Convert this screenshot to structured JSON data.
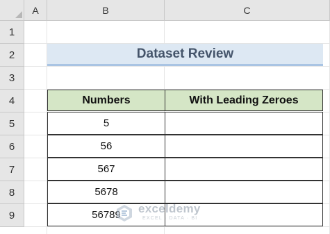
{
  "columns": [
    "A",
    "B",
    "C"
  ],
  "rows": [
    "1",
    "2",
    "3",
    "4",
    "5",
    "6",
    "7",
    "8",
    "9"
  ],
  "title": "Dataset Review",
  "table": {
    "headers": [
      "Numbers",
      "With Leading Zeroes"
    ],
    "rows": [
      [
        "5",
        ""
      ],
      [
        "56",
        ""
      ],
      [
        "567",
        ""
      ],
      [
        "5678",
        ""
      ],
      [
        "56789",
        ""
      ]
    ]
  },
  "watermark": {
    "name": "exceldemy",
    "tagline": "EXCEL · DATA · BI",
    "icon": "exceldemy-logo-icon"
  },
  "colors": {
    "header_fill": "#d5e6c6",
    "title_fill": "#dde8f3",
    "title_text": "#44546a"
  }
}
